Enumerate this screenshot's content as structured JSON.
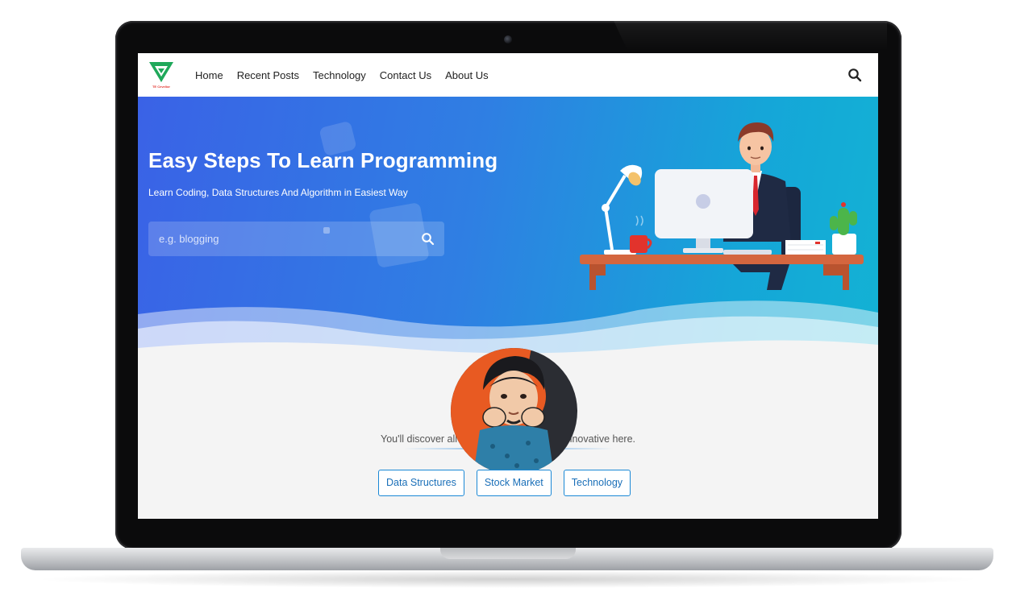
{
  "nav": {
    "logo_text": "TE Cevelior",
    "links": [
      "Home",
      "Recent Posts",
      "Technology",
      "Contact Us",
      "About Us"
    ]
  },
  "hero": {
    "title": "Easy Steps To Learn Programming",
    "subtitle": "Learn Coding, Data Structures And Algorithm in Easiest Way",
    "search_placeholder": "e.g. blogging"
  },
  "content": {
    "tagline": "You'll discover all of the latest interesting innovative here.",
    "tags": [
      "Data Structures",
      "Stock Market",
      "Technology"
    ]
  },
  "colors": {
    "hero_start": "#3a62e6",
    "hero_end": "#13b2d4",
    "tag_border": "#1a88d6",
    "logo_green": "#1fa85a",
    "logo_red": "#e2332c"
  }
}
